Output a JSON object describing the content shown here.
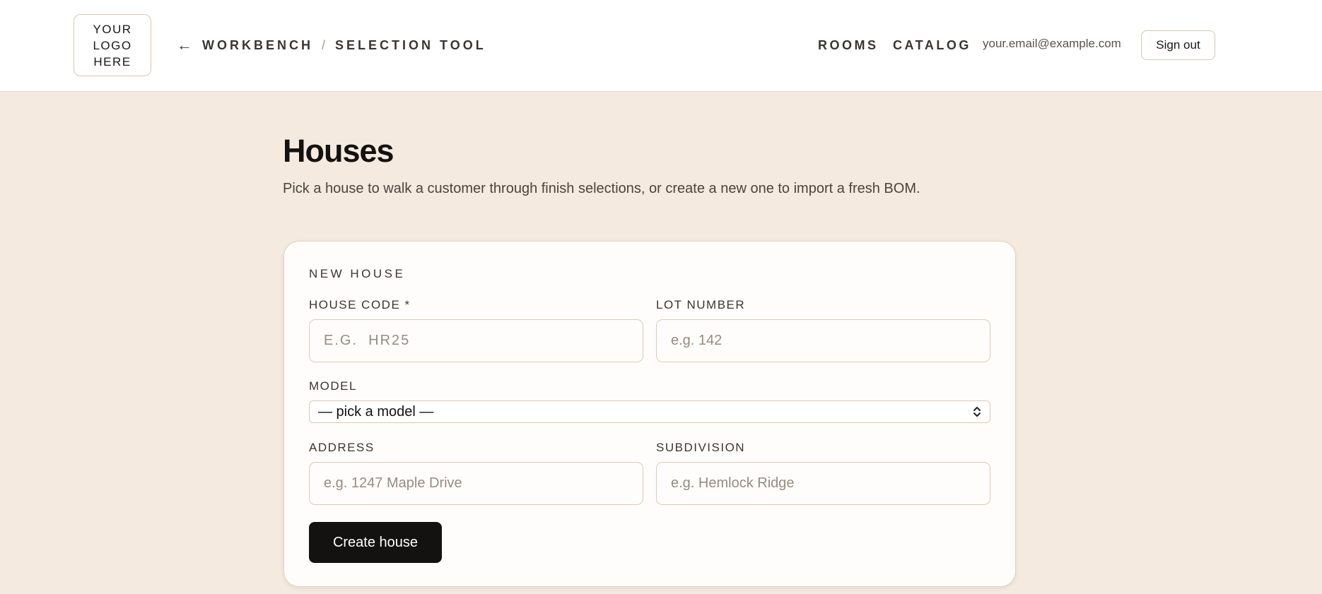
{
  "header": {
    "logo_lines": [
      "YOUR",
      "LOGO",
      "HERE"
    ],
    "back_icon": "left-arrow-icon",
    "breadcrumb": {
      "back_glyph": "←",
      "parent": "WORKBENCH",
      "separator": "/",
      "current": "SELECTION TOOL"
    },
    "nav": {
      "rooms": "ROOMS",
      "catalog": "CATALOG"
    },
    "user_email": "your.email@example.com",
    "sign_out": "Sign out"
  },
  "main": {
    "title": "Houses",
    "subtitle": "Pick a house to walk a customer through finish selections, or create a new one to import a fresh BOM."
  },
  "form": {
    "section_title": "NEW HOUSE",
    "house_code": {
      "label": "HOUSE CODE *",
      "value": "",
      "placeholder": "E.G.  HR25"
    },
    "lot_number": {
      "label": "LOT NUMBER",
      "value": "",
      "placeholder": "e.g. 142"
    },
    "model": {
      "label": "MODEL",
      "selected": "— pick a model —",
      "icon": "updown-chevron-icon"
    },
    "address": {
      "label": "ADDRESS",
      "value": "",
      "placeholder": "e.g. 1247 Maple Drive"
    },
    "subdivision": {
      "label": "SUBDIVISION",
      "value": "",
      "placeholder": "e.g. Hemlock Ridge"
    },
    "submit": "Create house"
  },
  "colors": {
    "page_background": "#f4eadf",
    "header_background": "#ffffff",
    "card_background": "#fffdfb",
    "primary_button": "#141210",
    "border": "#decab6"
  }
}
